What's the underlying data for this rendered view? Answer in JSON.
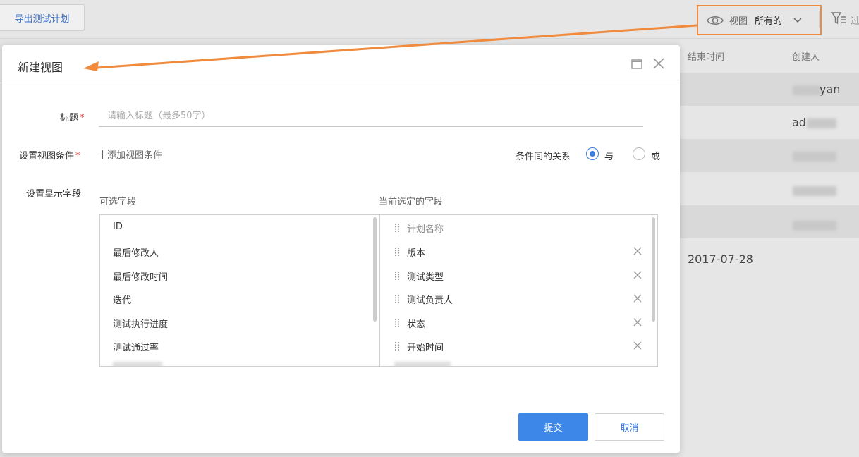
{
  "toolbar": {
    "export_label": "导出测试计划",
    "view_label": "视图",
    "view_value": "所有的",
    "filter_label": "过"
  },
  "table": {
    "headers": [
      "结束时间",
      "创建人"
    ],
    "creator_fragments": [
      "yan",
      "ad"
    ],
    "end_date": "2017-07-28"
  },
  "modal": {
    "title": "新建视图",
    "title_label": "标题",
    "title_placeholder": "请输入标题（最多50字）",
    "condition_label": "设置视图条件",
    "add_condition": "十添加视图条件",
    "relation_label": "条件间的关系",
    "relation_options": [
      "与",
      "或"
    ],
    "relation_selected": "与",
    "fields_label": "设置显示字段",
    "available_title": "可选字段",
    "selected_title": "当前选定的字段",
    "available_fields": [
      "ID",
      "最后修改人",
      "最后修改时间",
      "迭代",
      "测试执行进度",
      "测试通过率"
    ],
    "selected_fields": [
      {
        "label": "计划名称",
        "removable": false
      },
      {
        "label": "版本",
        "removable": true
      },
      {
        "label": "测试类型",
        "removable": true
      },
      {
        "label": "测试负责人",
        "removable": true
      },
      {
        "label": "状态",
        "removable": true
      },
      {
        "label": "开始时间",
        "removable": true
      }
    ],
    "submit_label": "提交",
    "cancel_label": "取消"
  },
  "colors": {
    "accent": "#3c87e8",
    "highlight": "#f08a3c",
    "required": "#e53935"
  }
}
